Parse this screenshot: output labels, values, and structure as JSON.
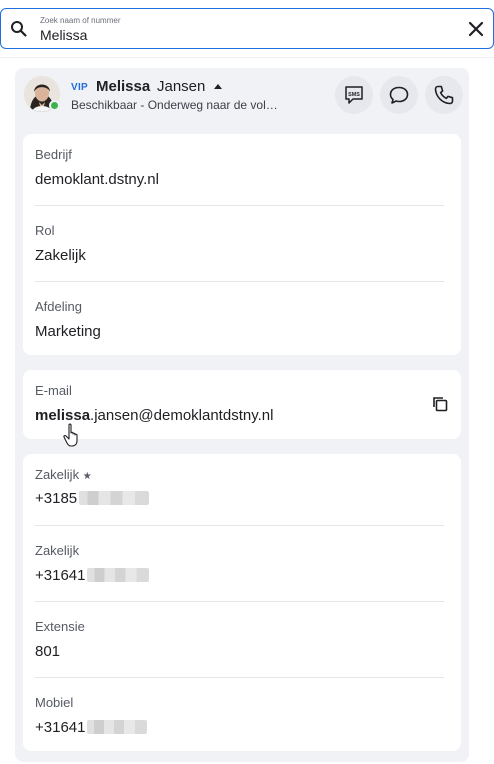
{
  "search": {
    "label": "Zoek naam of nummer",
    "value": "Melissa"
  },
  "contact": {
    "vip": "VIP",
    "first_name": "Melissa",
    "last_name": "Jansen",
    "status": "Beschikbaar - Onderweg naar de vol…",
    "presence": "available",
    "actions": {
      "sms": "SMS"
    }
  },
  "org_card": {
    "fields": [
      {
        "label": "Bedrijf",
        "value": "demoklant.dstny.nl"
      },
      {
        "label": "Rol",
        "value": "Zakelijk"
      },
      {
        "label": "Afdeling",
        "value": "Marketing"
      }
    ]
  },
  "email_card": {
    "label": "E-mail",
    "highlight": "melissa",
    "rest": ".jansen@demoklantdstny.nl"
  },
  "phone_card": {
    "fields": [
      {
        "label": "Zakelijk",
        "star": "★",
        "value": "+3185"
      },
      {
        "label": "Zakelijk",
        "value": "+31641"
      },
      {
        "label": "Extensie",
        "value": "801"
      },
      {
        "label": "Mobiel",
        "value": "+31641"
      }
    ]
  },
  "colors": {
    "accent": "#1f6fe0",
    "presence_green": "#3bb54a",
    "panel_bg": "#f1f2f6"
  }
}
